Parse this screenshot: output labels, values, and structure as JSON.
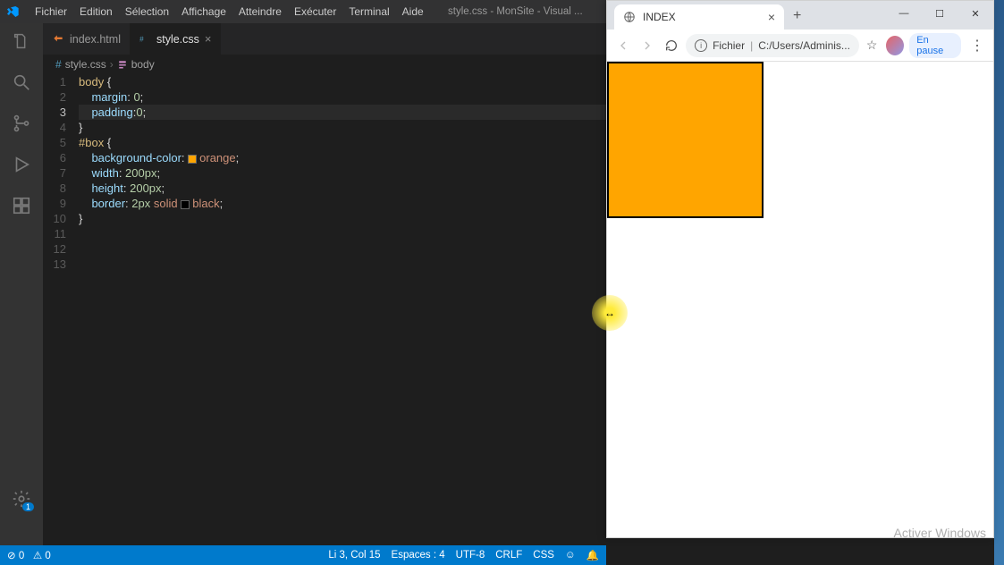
{
  "vscode": {
    "titlebar": {
      "menu": [
        "Fichier",
        "Edition",
        "Sélection",
        "Affichage",
        "Atteindre",
        "Exécuter",
        "Terminal",
        "Aide"
      ],
      "window_title": "style.css - MonSite - Visual ..."
    },
    "tabs": [
      {
        "label": "index.html",
        "active": false,
        "icon_color": "#e37933"
      },
      {
        "label": "style.css",
        "active": true,
        "icon_color": "#519aba"
      }
    ],
    "breadcrumb": {
      "file": "style.css",
      "symbol": "body"
    },
    "code": {
      "lines": [
        {
          "n": 1,
          "tokens": [
            {
              "t": "body",
              "c": "sel"
            },
            {
              "t": " ",
              "c": ""
            },
            {
              "t": "{",
              "c": "punc"
            }
          ]
        },
        {
          "n": 2,
          "tokens": [
            {
              "t": "    ",
              "c": "indent"
            },
            {
              "t": "margin",
              "c": "prop"
            },
            {
              "t": ": ",
              "c": ""
            },
            {
              "t": "0",
              "c": "num"
            },
            {
              "t": ";",
              "c": "punc"
            }
          ]
        },
        {
          "n": 3,
          "tokens": [
            {
              "t": "    ",
              "c": "indent"
            },
            {
              "t": "padding",
              "c": "prop"
            },
            {
              "t": ":",
              "c": ""
            },
            {
              "t": "0",
              "c": "num"
            },
            {
              "t": ";",
              "c": "punc"
            }
          ],
          "current": true
        },
        {
          "n": 4,
          "tokens": [
            {
              "t": "}",
              "c": "punc"
            }
          ]
        },
        {
          "n": 5,
          "tokens": [
            {
              "t": "#box",
              "c": "sel"
            },
            {
              "t": " {",
              "c": "punc"
            }
          ]
        },
        {
          "n": 6,
          "tokens": [
            {
              "t": "    ",
              "c": "indent"
            },
            {
              "t": "background-color",
              "c": "prop"
            },
            {
              "t": ": ",
              "c": ""
            },
            {
              "swatch": "orange"
            },
            {
              "t": "orange",
              "c": "val"
            },
            {
              "t": ";",
              "c": "punc"
            }
          ]
        },
        {
          "n": 7,
          "tokens": [
            {
              "t": "    ",
              "c": "indent"
            },
            {
              "t": "width",
              "c": "prop"
            },
            {
              "t": ": ",
              "c": ""
            },
            {
              "t": "200px",
              "c": "num"
            },
            {
              "t": ";",
              "c": "punc"
            }
          ]
        },
        {
          "n": 8,
          "tokens": [
            {
              "t": "    ",
              "c": "indent"
            },
            {
              "t": "height",
              "c": "prop"
            },
            {
              "t": ": ",
              "c": ""
            },
            {
              "t": "200px",
              "c": "num"
            },
            {
              "t": ";",
              "c": "punc"
            }
          ]
        },
        {
          "n": 9,
          "tokens": [
            {
              "t": "    ",
              "c": "indent"
            },
            {
              "t": "border",
              "c": "prop"
            },
            {
              "t": ": ",
              "c": ""
            },
            {
              "t": "2px",
              "c": "num"
            },
            {
              "t": " ",
              "c": ""
            },
            {
              "t": "solid",
              "c": "val"
            },
            {
              "t": " ",
              "c": ""
            },
            {
              "swatch": "black"
            },
            {
              "t": "black",
              "c": "val"
            },
            {
              "t": ";",
              "c": "punc"
            }
          ]
        },
        {
          "n": 10,
          "tokens": [
            {
              "t": "}",
              "c": "punc"
            }
          ]
        },
        {
          "n": 11,
          "tokens": []
        },
        {
          "n": 12,
          "tokens": []
        },
        {
          "n": 13,
          "tokens": []
        }
      ]
    },
    "statusbar": {
      "left": {
        "errors": "0",
        "warnings": "0"
      },
      "right": {
        "cursor": "Li 3, Col 15",
        "spaces": "Espaces : 4",
        "encoding": "UTF-8",
        "eol": "CRLF",
        "lang": "CSS",
        "feedback": "☺",
        "bell": "🔔"
      }
    },
    "activity_badge": "1"
  },
  "chrome": {
    "tab_title": "INDEX",
    "toolbar": {
      "scheme_label": "Fichier",
      "url": "C:/Users/Adminis...",
      "pause_label": "En pause"
    }
  },
  "watermark": "Activer Windows"
}
